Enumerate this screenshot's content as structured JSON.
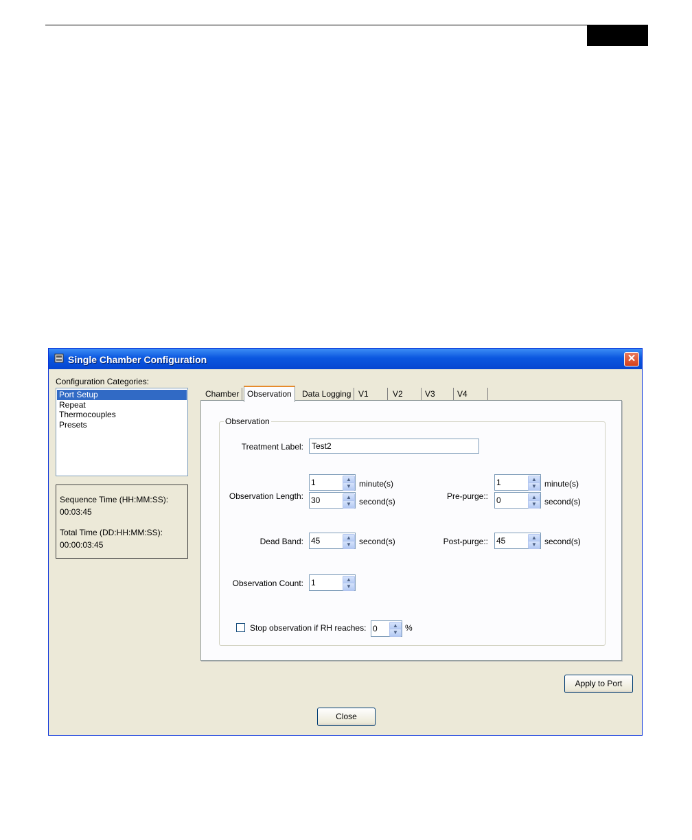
{
  "dialog": {
    "title": "Single Chamber Configuration",
    "close_glyph": "✕",
    "icon": "app-window-icon"
  },
  "sidebar": {
    "label": "Configuration Categories:",
    "items": [
      {
        "label": "Port Setup",
        "selected": true
      },
      {
        "label": "Repeat",
        "selected": false
      },
      {
        "label": "Thermocouples",
        "selected": false
      },
      {
        "label": "Presets",
        "selected": false
      }
    ],
    "sequence_time_label": "Sequence Time (HH:MM:SS):",
    "sequence_time_value": "00:03:45",
    "total_time_label": "Total Time (DD:HH:MM:SS):",
    "total_time_value": "00:00:03:45"
  },
  "tabs": [
    {
      "label": "Chamber",
      "active": false
    },
    {
      "label": "Observation",
      "active": true
    },
    {
      "label": "Data Logging",
      "active": false
    },
    {
      "label": "V1",
      "active": false
    },
    {
      "label": "V2",
      "active": false
    },
    {
      "label": "V3",
      "active": false
    },
    {
      "label": "V4",
      "active": false
    }
  ],
  "observation": {
    "group_title": "Observation",
    "treatment_label": {
      "label": "Treatment Label:",
      "value": "Test2"
    },
    "observation_length": {
      "label": "Observation Length:",
      "minutes": "1",
      "seconds": "30"
    },
    "pre_purge": {
      "label": "Pre-purge::",
      "minutes": "1",
      "seconds": "0"
    },
    "dead_band": {
      "label": "Dead Band:",
      "seconds": "45"
    },
    "post_purge": {
      "label": "Post-purge::",
      "seconds": "45"
    },
    "observation_count": {
      "label": "Observation Count:",
      "value": "1"
    },
    "stop_rh": {
      "label": "Stop observation if RH reaches:",
      "value": "0",
      "unit": "%",
      "checked": false
    },
    "unit_minutes": "minute(s)",
    "unit_seconds": "second(s)"
  },
  "buttons": {
    "apply": "Apply to Port",
    "close": "Close"
  },
  "spinner": {
    "up": "▲",
    "down": "▼"
  }
}
